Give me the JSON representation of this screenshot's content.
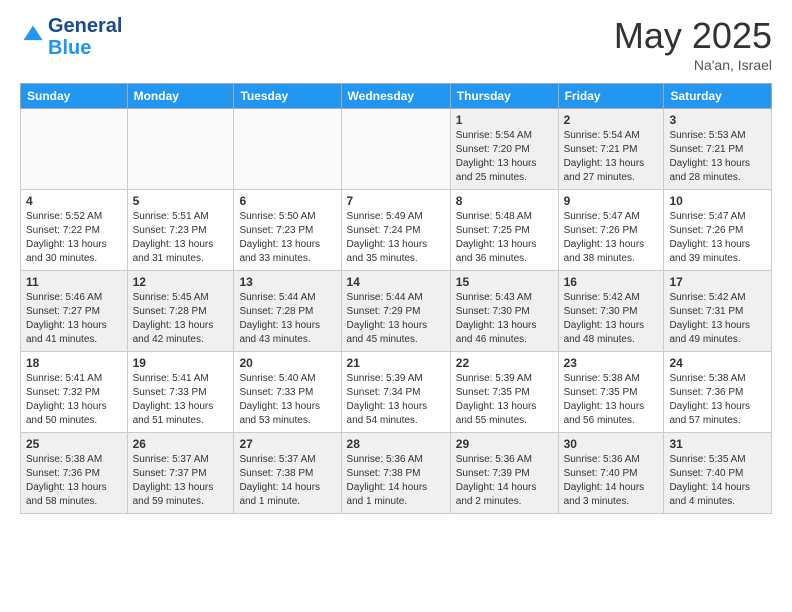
{
  "logo": {
    "line1": "General",
    "line2": "Blue"
  },
  "header": {
    "month": "May 2025",
    "location": "Na'an, Israel"
  },
  "days_of_week": [
    "Sunday",
    "Monday",
    "Tuesday",
    "Wednesday",
    "Thursday",
    "Friday",
    "Saturday"
  ],
  "weeks": [
    [
      {
        "day": "",
        "info": ""
      },
      {
        "day": "",
        "info": ""
      },
      {
        "day": "",
        "info": ""
      },
      {
        "day": "",
        "info": ""
      },
      {
        "day": "1",
        "info": "Sunrise: 5:54 AM\nSunset: 7:20 PM\nDaylight: 13 hours\nand 25 minutes."
      },
      {
        "day": "2",
        "info": "Sunrise: 5:54 AM\nSunset: 7:21 PM\nDaylight: 13 hours\nand 27 minutes."
      },
      {
        "day": "3",
        "info": "Sunrise: 5:53 AM\nSunset: 7:21 PM\nDaylight: 13 hours\nand 28 minutes."
      }
    ],
    [
      {
        "day": "4",
        "info": "Sunrise: 5:52 AM\nSunset: 7:22 PM\nDaylight: 13 hours\nand 30 minutes."
      },
      {
        "day": "5",
        "info": "Sunrise: 5:51 AM\nSunset: 7:23 PM\nDaylight: 13 hours\nand 31 minutes."
      },
      {
        "day": "6",
        "info": "Sunrise: 5:50 AM\nSunset: 7:23 PM\nDaylight: 13 hours\nand 33 minutes."
      },
      {
        "day": "7",
        "info": "Sunrise: 5:49 AM\nSunset: 7:24 PM\nDaylight: 13 hours\nand 35 minutes."
      },
      {
        "day": "8",
        "info": "Sunrise: 5:48 AM\nSunset: 7:25 PM\nDaylight: 13 hours\nand 36 minutes."
      },
      {
        "day": "9",
        "info": "Sunrise: 5:47 AM\nSunset: 7:26 PM\nDaylight: 13 hours\nand 38 minutes."
      },
      {
        "day": "10",
        "info": "Sunrise: 5:47 AM\nSunset: 7:26 PM\nDaylight: 13 hours\nand 39 minutes."
      }
    ],
    [
      {
        "day": "11",
        "info": "Sunrise: 5:46 AM\nSunset: 7:27 PM\nDaylight: 13 hours\nand 41 minutes."
      },
      {
        "day": "12",
        "info": "Sunrise: 5:45 AM\nSunset: 7:28 PM\nDaylight: 13 hours\nand 42 minutes."
      },
      {
        "day": "13",
        "info": "Sunrise: 5:44 AM\nSunset: 7:28 PM\nDaylight: 13 hours\nand 43 minutes."
      },
      {
        "day": "14",
        "info": "Sunrise: 5:44 AM\nSunset: 7:29 PM\nDaylight: 13 hours\nand 45 minutes."
      },
      {
        "day": "15",
        "info": "Sunrise: 5:43 AM\nSunset: 7:30 PM\nDaylight: 13 hours\nand 46 minutes."
      },
      {
        "day": "16",
        "info": "Sunrise: 5:42 AM\nSunset: 7:30 PM\nDaylight: 13 hours\nand 48 minutes."
      },
      {
        "day": "17",
        "info": "Sunrise: 5:42 AM\nSunset: 7:31 PM\nDaylight: 13 hours\nand 49 minutes."
      }
    ],
    [
      {
        "day": "18",
        "info": "Sunrise: 5:41 AM\nSunset: 7:32 PM\nDaylight: 13 hours\nand 50 minutes."
      },
      {
        "day": "19",
        "info": "Sunrise: 5:41 AM\nSunset: 7:33 PM\nDaylight: 13 hours\nand 51 minutes."
      },
      {
        "day": "20",
        "info": "Sunrise: 5:40 AM\nSunset: 7:33 PM\nDaylight: 13 hours\nand 53 minutes."
      },
      {
        "day": "21",
        "info": "Sunrise: 5:39 AM\nSunset: 7:34 PM\nDaylight: 13 hours\nand 54 minutes."
      },
      {
        "day": "22",
        "info": "Sunrise: 5:39 AM\nSunset: 7:35 PM\nDaylight: 13 hours\nand 55 minutes."
      },
      {
        "day": "23",
        "info": "Sunrise: 5:38 AM\nSunset: 7:35 PM\nDaylight: 13 hours\nand 56 minutes."
      },
      {
        "day": "24",
        "info": "Sunrise: 5:38 AM\nSunset: 7:36 PM\nDaylight: 13 hours\nand 57 minutes."
      }
    ],
    [
      {
        "day": "25",
        "info": "Sunrise: 5:38 AM\nSunset: 7:36 PM\nDaylight: 13 hours\nand 58 minutes."
      },
      {
        "day": "26",
        "info": "Sunrise: 5:37 AM\nSunset: 7:37 PM\nDaylight: 13 hours\nand 59 minutes."
      },
      {
        "day": "27",
        "info": "Sunrise: 5:37 AM\nSunset: 7:38 PM\nDaylight: 14 hours\nand 1 minute."
      },
      {
        "day": "28",
        "info": "Sunrise: 5:36 AM\nSunset: 7:38 PM\nDaylight: 14 hours\nand 1 minute."
      },
      {
        "day": "29",
        "info": "Sunrise: 5:36 AM\nSunset: 7:39 PM\nDaylight: 14 hours\nand 2 minutes."
      },
      {
        "day": "30",
        "info": "Sunrise: 5:36 AM\nSunset: 7:40 PM\nDaylight: 14 hours\nand 3 minutes."
      },
      {
        "day": "31",
        "info": "Sunrise: 5:35 AM\nSunset: 7:40 PM\nDaylight: 14 hours\nand 4 minutes."
      }
    ]
  ]
}
